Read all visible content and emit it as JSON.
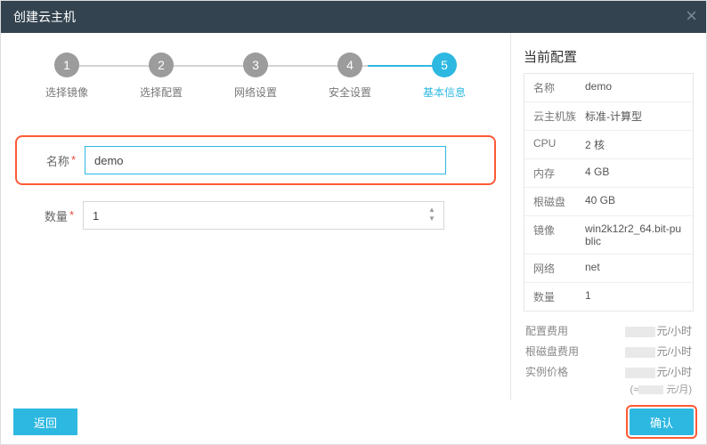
{
  "header": {
    "title": "创建云主机",
    "close_label": "×"
  },
  "steps": [
    {
      "num": "1",
      "label": "选择镜像"
    },
    {
      "num": "2",
      "label": "选择配置"
    },
    {
      "num": "3",
      "label": "网络设置"
    },
    {
      "num": "4",
      "label": "安全设置"
    },
    {
      "num": "5",
      "label": "基本信息"
    }
  ],
  "form": {
    "name_label": "名称",
    "name_value": "demo",
    "qty_label": "数量",
    "qty_value": "1"
  },
  "right": {
    "title": "当前配置",
    "rows": [
      {
        "k": "名称",
        "v": "demo"
      },
      {
        "k": "云主机族",
        "v": "标准-计算型"
      },
      {
        "k": "CPU",
        "v": "2 核"
      },
      {
        "k": "内存",
        "v": "4 GB"
      },
      {
        "k": "根磁盘",
        "v": "40 GB"
      },
      {
        "k": "镜像",
        "v": "win2k12r2_64.bit-public"
      },
      {
        "k": "网络",
        "v": "net"
      },
      {
        "k": "数量",
        "v": "1"
      }
    ],
    "price": {
      "cfg_label": "配置费用",
      "disk_label": "根磁盘费用",
      "inst_label": "实例价格",
      "unit_hour": "元/小时",
      "unit_month_prefix": "(≈",
      "unit_month_suffix": " 元/月)"
    }
  },
  "footer": {
    "back": "返回",
    "confirm": "确认"
  }
}
